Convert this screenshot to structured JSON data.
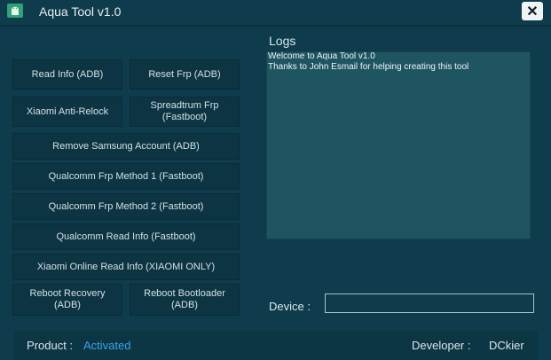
{
  "window": {
    "title": "Aqua Tool v1.0",
    "close_symbol": "✕"
  },
  "buttons": [
    {
      "label": "Read Info (ADB)"
    },
    {
      "label": "Reset Frp (ADB)"
    },
    {
      "label": "Xiaomi Anti-Relock"
    },
    {
      "label": "Spreadtrum Frp (Fastboot)"
    },
    {
      "label": "Remove Samsung Account (ADB)"
    },
    {
      "label": "Qualcomm Frp Method 1 (Fastboot)"
    },
    {
      "label": "Qualcomm Frp Method 2 (Fastboot)"
    },
    {
      "label": "Qualcomm Read Info (Fastboot)"
    },
    {
      "label": "Xiaomi Online Read Info (XIAOMI ONLY)"
    },
    {
      "label": "Reboot Recovery (ADB)"
    },
    {
      "label": "Reboot Bootloader (ADB)"
    }
  ],
  "logs": {
    "label": "Logs",
    "lines": [
      "Welcome to Aqua Tool v1.0",
      "Thanks to John Esmail for helping creating this tool"
    ]
  },
  "device": {
    "label": "Device :",
    "value": ""
  },
  "footer": {
    "product_label": "Product :",
    "product_status": "Activated",
    "developer_label": "Developer :",
    "developer_name": "DCkier"
  },
  "colors": {
    "accent": "#3aa3e6",
    "background": "#0f3c4c",
    "logs_bg": "#1f5560"
  }
}
